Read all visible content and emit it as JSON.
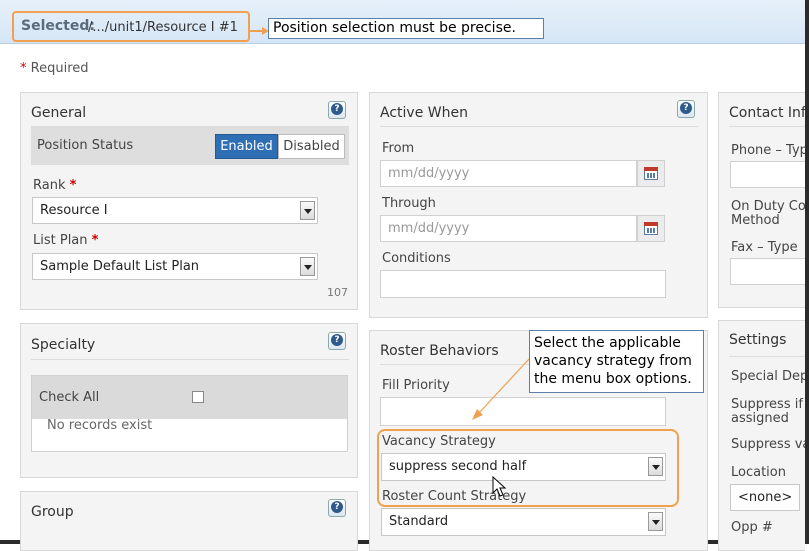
{
  "header": {
    "selected_label": "Selected:",
    "selected_path": "/.../unit1/Resource I #1",
    "callout": "Position selection must be precise."
  },
  "required_note": "Required",
  "general": {
    "title": "General",
    "position_status_label": "Position Status",
    "enabled_label": "Enabled",
    "disabled_label": "Disabled",
    "rank_label": "Rank",
    "rank_value": "Resource I",
    "list_plan_label": "List Plan",
    "list_plan_value": "Sample Default List Plan",
    "count": "107"
  },
  "specialty": {
    "title": "Specialty",
    "check_all_label": "Check All",
    "no_records": "No records exist"
  },
  "group": {
    "title": "Group"
  },
  "active_when": {
    "title": "Active When",
    "from_label": "From",
    "from_placeholder": "mm/dd/yyyy",
    "through_label": "Through",
    "through_placeholder": "mm/dd/yyyy",
    "conditions_label": "Conditions"
  },
  "roster": {
    "title": "Roster Behaviors",
    "fill_priority_label": "Fill Priority",
    "vacancy_label": "Vacancy Strategy",
    "vacancy_value": "suppress second half",
    "roster_count_label": "Roster Count Strategy",
    "roster_count_value": "Standard",
    "callout_lines": [
      "Select the applicable",
      "vacancy strategy from",
      "the menu box options."
    ]
  },
  "contact": {
    "title": "Contact Inf",
    "phone_label": "Phone – Typ",
    "onduty_label_1": "On Duty Co",
    "onduty_label_2": "Method",
    "fax_label": "Fax – Type"
  },
  "settings": {
    "title": "Settings",
    "special_label": "Special Dep",
    "suppress_label_1": "Suppress if",
    "suppress_label_2": "assigned",
    "suppress_va_label": "Suppress va",
    "location_label": "Location",
    "location_value": "<none>",
    "opp_label": "Opp #"
  },
  "colors": {
    "accent": "#2e6eb5",
    "highlight": "#f0a050",
    "required": "#cc0000"
  }
}
